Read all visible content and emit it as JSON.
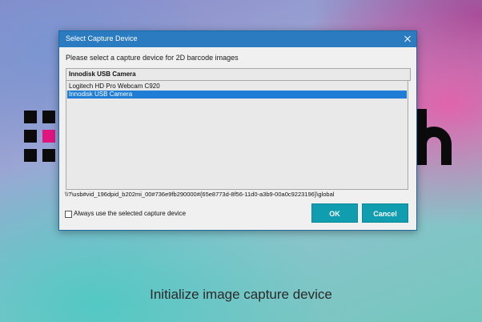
{
  "dialog": {
    "title": "Select Capture Device",
    "prompt": "Please select a capture device for 2D barcode images",
    "selected_device": "Innodisk USB Camera",
    "devices": [
      {
        "label": "Logitech HD Pro Webcam C920",
        "selected": false
      },
      {
        "label": "Innodisk USB Camera",
        "selected": true
      }
    ],
    "device_path": "\\\\?\\usb#vid_196dpid_b202mi_00#736e9fb290000#{65e8773d-8f56-11d0-a3b9-00a0c9223196}\\global",
    "always_use_label": "Always use the selected capture device",
    "always_use_checked": false,
    "ok_label": "OK",
    "cancel_label": "Cancel"
  },
  "caption": "Initialize image capture device",
  "colors": {
    "titlebar": "#2b7bc0",
    "selection": "#1f7dd6",
    "button": "#119db0",
    "logo_accent": "#e0157f"
  }
}
